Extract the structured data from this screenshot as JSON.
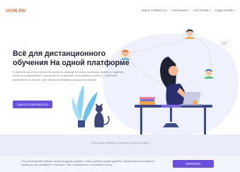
{
  "header": {
    "logo": "UCHI.RU",
    "nav": [
      {
        "label": "НАШИ СЕРВИСЫ"
      },
      {
        "label": "УЧЕНИКАМ"
      },
      {
        "label": "УЧИТЕЛЯМ"
      },
      {
        "label": "РОДИТЕЛЯМ"
      }
    ],
    "chevron": "▾"
  },
  "hero": {
    "title": "Всё для дистанционного обучения На одной платформе",
    "description": "В базовом мастере учителя бесплатные сервисы по всему учебному процессу: задания, занятия и упражнения в одном месте, и удобные инструменты учителя, с системой расписаний и тестами, для любой программы и возраста учеников.",
    "cta_label": "НАЧАТЬ ПОЛЬЗОВАТЬСЯ"
  },
  "band": {
    "caption": "Платформа занятий с учителем Учи.ру для школ"
  },
  "cookie": {
    "text": "Учи.ру использует файлы cookie на другие данные, чтобы сделать сервис удобнее. Продолжая пользоваться сервисом, вы нажимаете «Принять». Вы соглашаетесь с политикой Учи.ру.",
    "accept_label": "ПРИНЯТЬ"
  },
  "colors": {
    "accent": "#6b4fe0",
    "brand": "#f05a28",
    "band": "#e9ecf8"
  }
}
